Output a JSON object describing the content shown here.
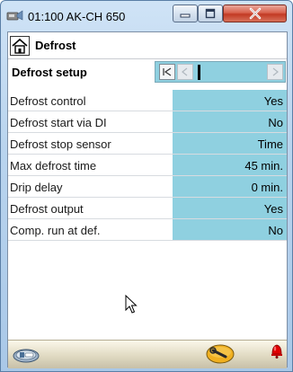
{
  "window": {
    "title": "01:100 AK-CH 650",
    "buttons": [
      "minimize",
      "maximize",
      "close"
    ]
  },
  "header": {
    "title": "Defrost",
    "home_icon": "home-icon"
  },
  "setup": {
    "label": "Defrost setup",
    "nav_buttons": [
      "first",
      "previous",
      "next"
    ]
  },
  "params": [
    {
      "label": "Defrost control",
      "value": "Yes"
    },
    {
      "label": "Defrost start via DI",
      "value": "No"
    },
    {
      "label": "Defrost stop sensor",
      "value": "Time"
    },
    {
      "label": "Max defrost time",
      "value": "45 min."
    },
    {
      "label": "Drip delay",
      "value": "0 min."
    },
    {
      "label": "Defrost output",
      "value": "Yes"
    },
    {
      "label": "Comp. run at def.",
      "value": "No"
    }
  ],
  "footer": {
    "left_icon": "login-icon",
    "wrench_icon": "wrench-icon",
    "alarm_icon": "alarm-bell-icon"
  },
  "colors": {
    "value_cell": "#8fd0e0",
    "alarm": "#e00000",
    "wrench_badge": "#f0b020"
  }
}
